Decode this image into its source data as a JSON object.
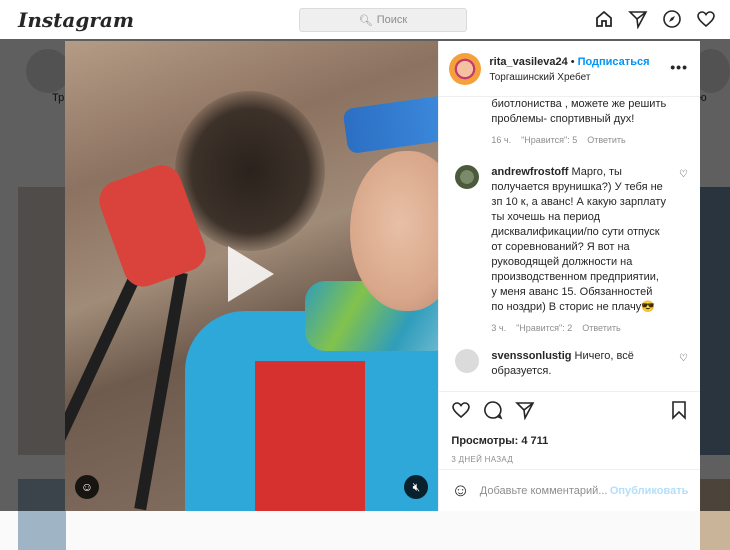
{
  "topbar": {
    "logo": "Instagram",
    "search_placeholder": "Поиск"
  },
  "background": {
    "story_label_left": "Тр",
    "story_label_right": "лю"
  },
  "post": {
    "username": "rita_vasileva24",
    "follow_label": "Подписаться",
    "location": "Торгашинский Хребет",
    "caption_tail": "биотлониства , можете же решить проблемы- спортивный дух!",
    "caption_meta": {
      "time": "16 ч.",
      "likes": "\"Нравится\": 5",
      "reply": "Ответить"
    },
    "comments": [
      {
        "user": "andrewfrostoff",
        "text": "Марго, ты получается врунишка?) У тебя не зп 10 к, а аванс! А какую зарплату ты хочешь на период дисквалификации/по сути отпуск от соревнований? Я вот на руководящей должности на производственном предприятии, у меня аванс 15. Обязанностей по ноздри) В сторис не плачу😎",
        "time": "3 ч.",
        "likes": "\"Нравится\": 2",
        "reply": "Ответить"
      },
      {
        "user": "svenssonlustig",
        "text": "Ничего, всё образуется.",
        "time": "",
        "likes": "",
        "reply": ""
      }
    ],
    "views": "Просмотры: 4 711",
    "date": "3 ДНЕЙ НАЗАД",
    "add_comment_placeholder": "Добавьте комментарий...",
    "publish_label": "Опубликовать"
  }
}
